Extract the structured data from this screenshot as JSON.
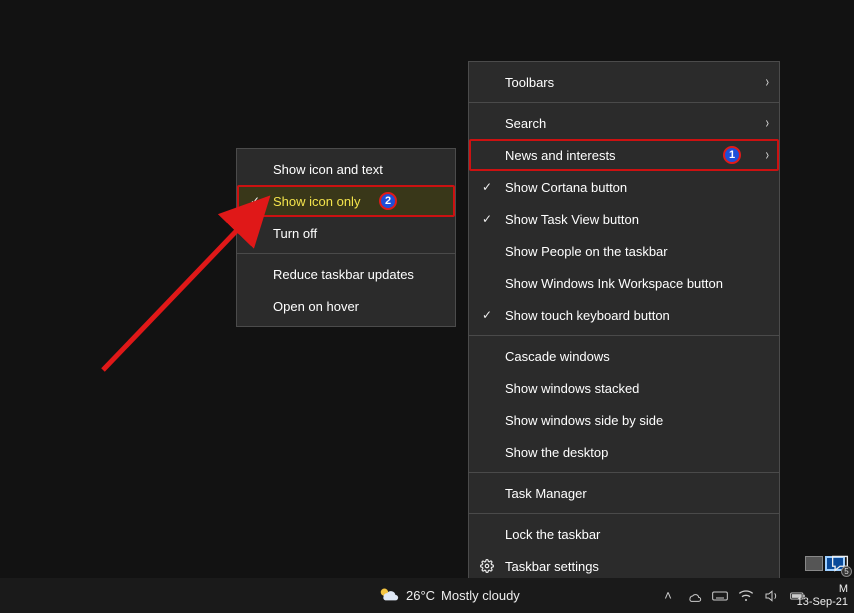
{
  "main_menu": {
    "toolbars": "Toolbars",
    "search": "Search",
    "news": "News and interests",
    "cortana": "Show Cortana button",
    "taskview": "Show Task View button",
    "people": "Show People on the taskbar",
    "ink": "Show Windows Ink Workspace button",
    "touchkb": "Show touch keyboard button",
    "cascade": "Cascade windows",
    "stacked": "Show windows stacked",
    "sidebyside": "Show windows side by side",
    "showdesktop": "Show the desktop",
    "taskmgr": "Task Manager",
    "lock": "Lock the taskbar",
    "settings": "Taskbar settings"
  },
  "sub_menu": {
    "icon_text": "Show icon and text",
    "icon_only": "Show icon only",
    "turn_off": "Turn off",
    "reduce": "Reduce taskbar updates",
    "hover": "Open on hover"
  },
  "annotations": {
    "n1": "1",
    "n2": "2"
  },
  "taskbar": {
    "temp": "26°C",
    "weather": "Mostly cloudy",
    "time_top": "M",
    "date": "13-Sep-21",
    "notif_count": "5"
  }
}
